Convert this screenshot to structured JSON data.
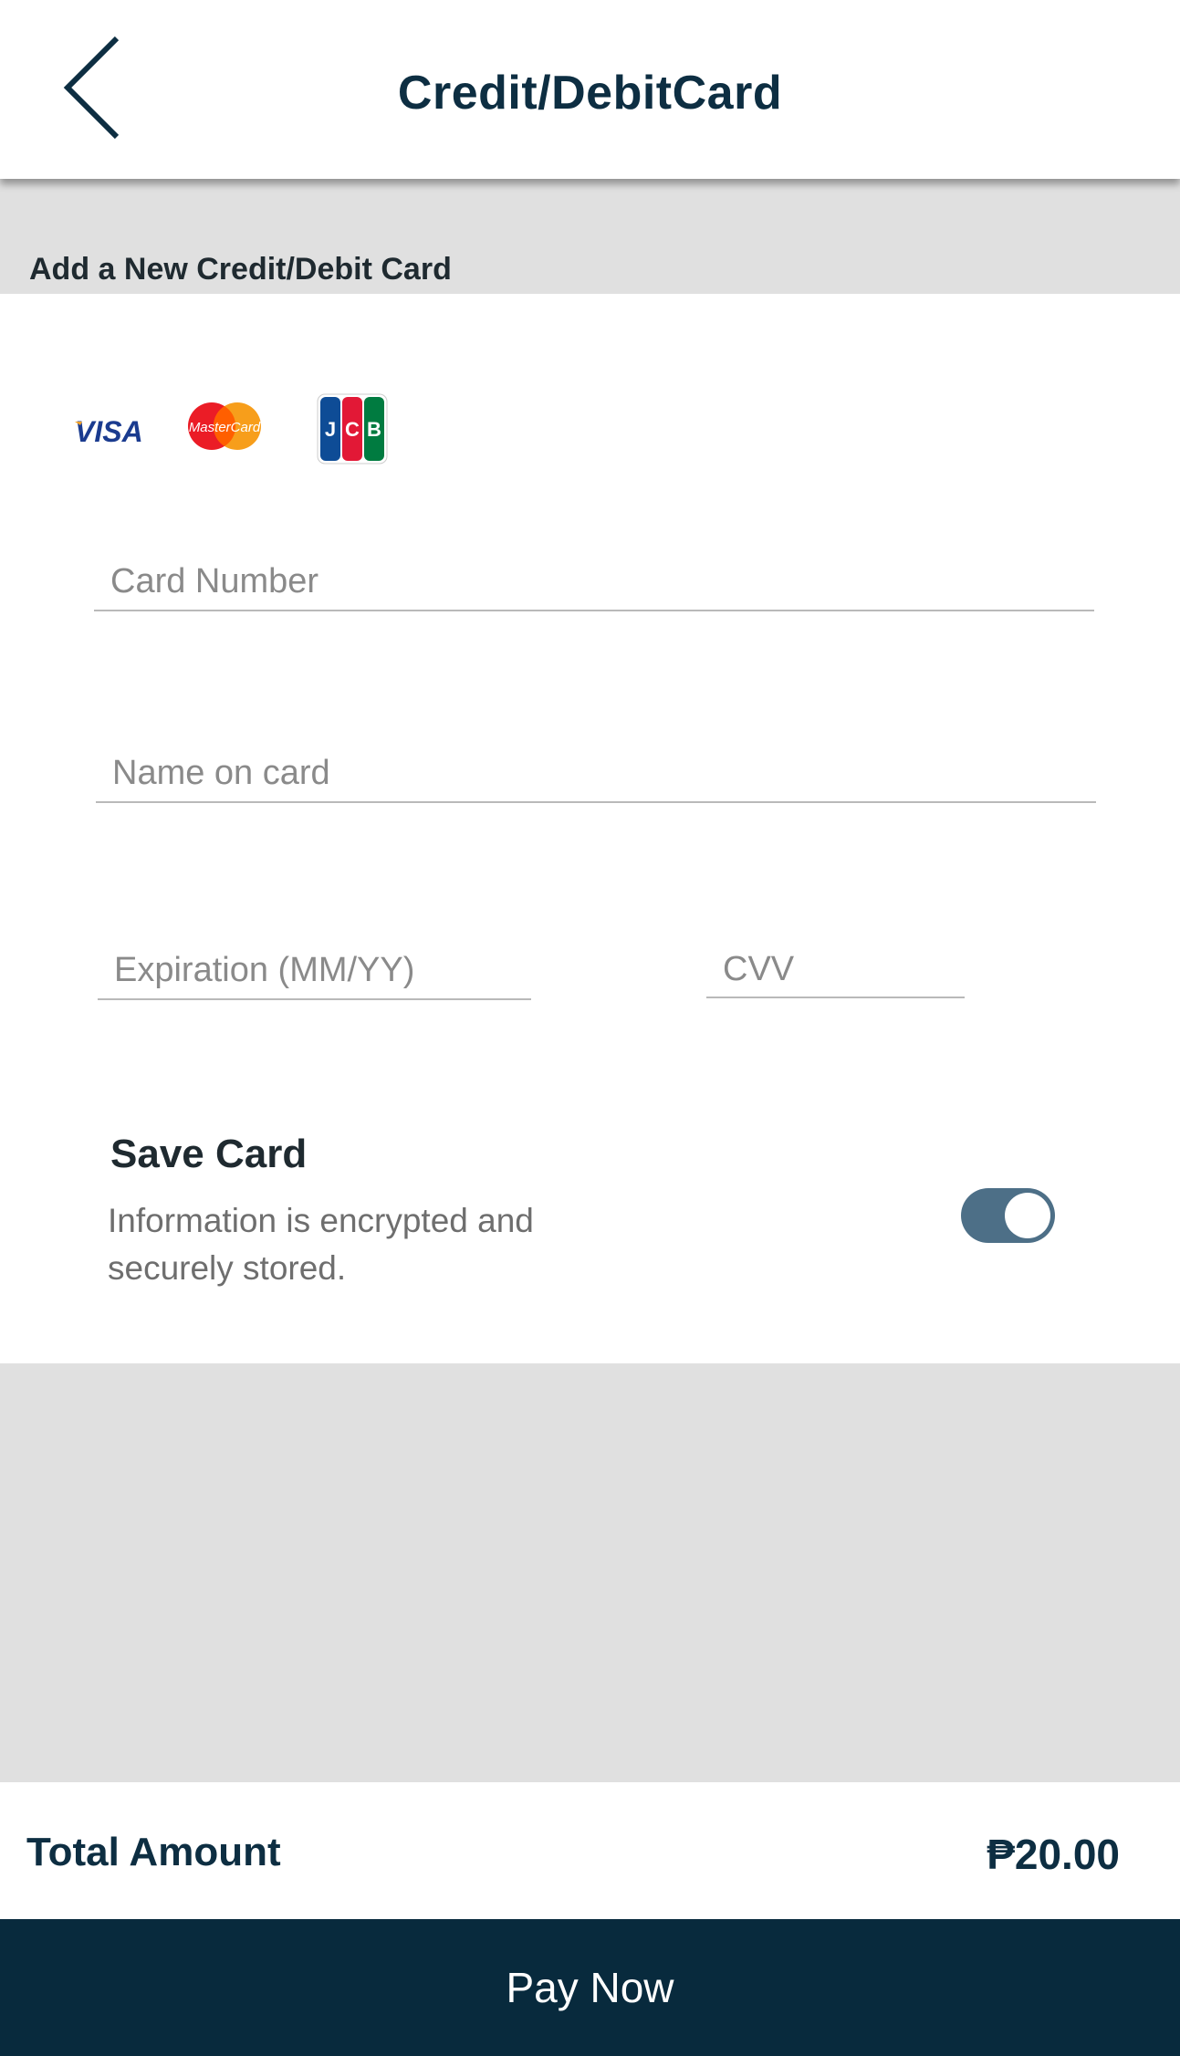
{
  "header": {
    "title": "Credit/DebitCard",
    "back_icon": "chevron-left-icon"
  },
  "section": {
    "label": "Add a New Credit/Debit Card"
  },
  "card_brands": [
    {
      "name": "VISA",
      "icon": "visa-logo"
    },
    {
      "name": "MasterCard",
      "icon": "mastercard-logo"
    },
    {
      "name": "JCB",
      "icon": "jcb-logo"
    }
  ],
  "form": {
    "card_number_placeholder": "Card Number",
    "card_number_value": "",
    "name_placeholder": "Name on card",
    "name_value": "",
    "expiration_placeholder": "Expiration (MM/YY)",
    "expiration_value": "",
    "cvv_placeholder": "CVV",
    "cvv_value": ""
  },
  "save_card": {
    "title": "Save Card",
    "description": "Information is encrypted and securely stored.",
    "enabled": true,
    "toggle_color": "#4d6f87"
  },
  "total": {
    "label": "Total Amount",
    "amount": "₱20.00"
  },
  "pay_button": {
    "label": "Pay Now",
    "color": "#082a3d"
  },
  "colors": {
    "primary_text": "#0d2e42",
    "background": "#e0e0e0"
  }
}
